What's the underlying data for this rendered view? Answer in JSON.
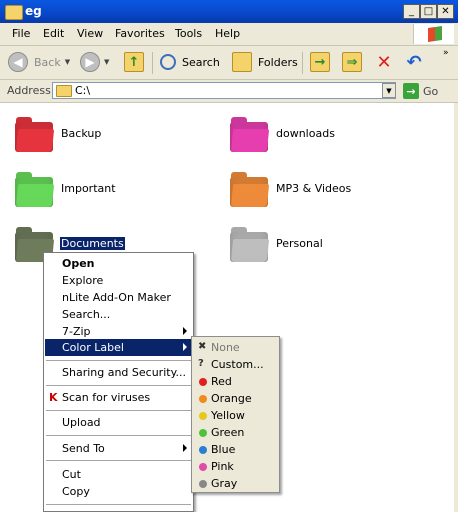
{
  "window": {
    "title": "eg",
    "controls": {
      "minimize": "_",
      "maximize": "□",
      "close": "✕"
    }
  },
  "menubar": {
    "items": [
      "File",
      "Edit",
      "View",
      "Favorites",
      "Tools",
      "Help"
    ]
  },
  "toolbar": {
    "back_label": "Back",
    "search_label": "Search",
    "folders_label": "Folders",
    "icons": [
      "back-arrow-icon",
      "forward-arrow-icon",
      "up-folder-icon",
      "search-icon",
      "folders-icon",
      "move-to-icon",
      "copy-to-icon",
      "delete-icon",
      "undo-icon"
    ]
  },
  "address": {
    "label": "Address",
    "value": "C:\\",
    "go_label": "Go"
  },
  "folders": [
    {
      "name": "Backup",
      "color": "#e8343f"
    },
    {
      "name": "downloads",
      "color": "#e83fb0"
    },
    {
      "name": "Important",
      "color": "#67d95a"
    },
    {
      "name": "MP3 & Videos",
      "color": "#f08c3a"
    },
    {
      "name": "Documents",
      "color": "#6f7d5c",
      "selected": true
    },
    {
      "name": "Personal",
      "color": "#bfbfbf"
    }
  ],
  "context_menu": {
    "open": "Open",
    "explore": "Explore",
    "nlite": "nLite Add-On Maker",
    "search": "Search...",
    "zip": "7-Zip",
    "color_label": "Color Label",
    "sharing": "Sharing and Security...",
    "scan": "Scan for viruses",
    "upload": "Upload",
    "send_to": "Send To",
    "cut": "Cut",
    "copy": "Copy"
  },
  "color_submenu": {
    "none": "None",
    "custom": "Custom...",
    "colors": [
      {
        "label": "Red",
        "hex": "#e02020"
      },
      {
        "label": "Orange",
        "hex": "#f08a1a"
      },
      {
        "label": "Yellow",
        "hex": "#e6c81a"
      },
      {
        "label": "Green",
        "hex": "#4fc23a"
      },
      {
        "label": "Blue",
        "hex": "#2a7fd4"
      },
      {
        "label": "Pink",
        "hex": "#e04aa8"
      },
      {
        "label": "Gray",
        "hex": "#888888"
      }
    ]
  }
}
